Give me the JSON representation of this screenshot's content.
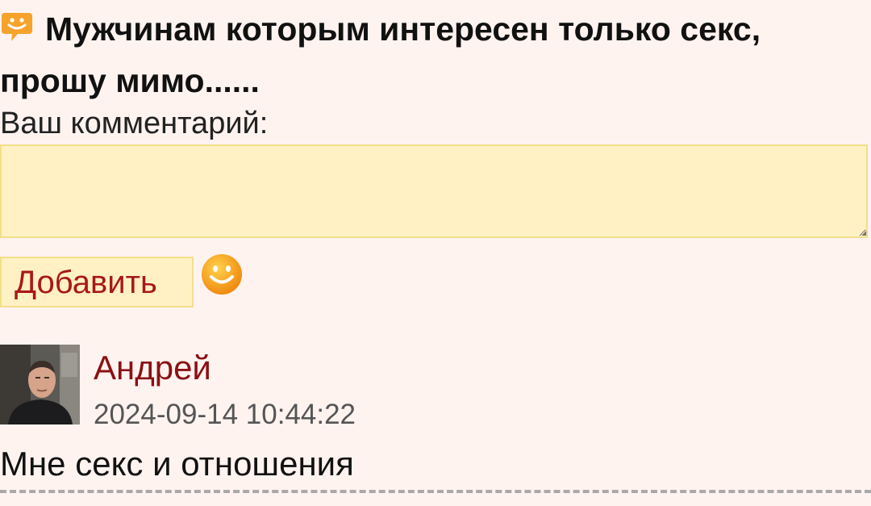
{
  "post": {
    "title": "Мужчинам которым интересен только секс, прошу мимо......",
    "title_icon": "speech-bubble-smile-icon"
  },
  "comment_form": {
    "label": "Ваш комментарий:",
    "textarea_value": "",
    "submit_label": "Добавить",
    "emoji_icon": "smiley-face-icon"
  },
  "comments": [
    {
      "author": "Андрей",
      "date": "2024-09-14 10:44:22",
      "text": "Мне секс и отношения",
      "avatar_icon": "user-avatar-photo"
    }
  ],
  "colors": {
    "background": "#fff3f0",
    "input_background": "#fff1c4",
    "input_border": "#f2df8a",
    "button_text": "#a8171b",
    "author_link": "#8b1014",
    "emoji": "#f39a16"
  }
}
